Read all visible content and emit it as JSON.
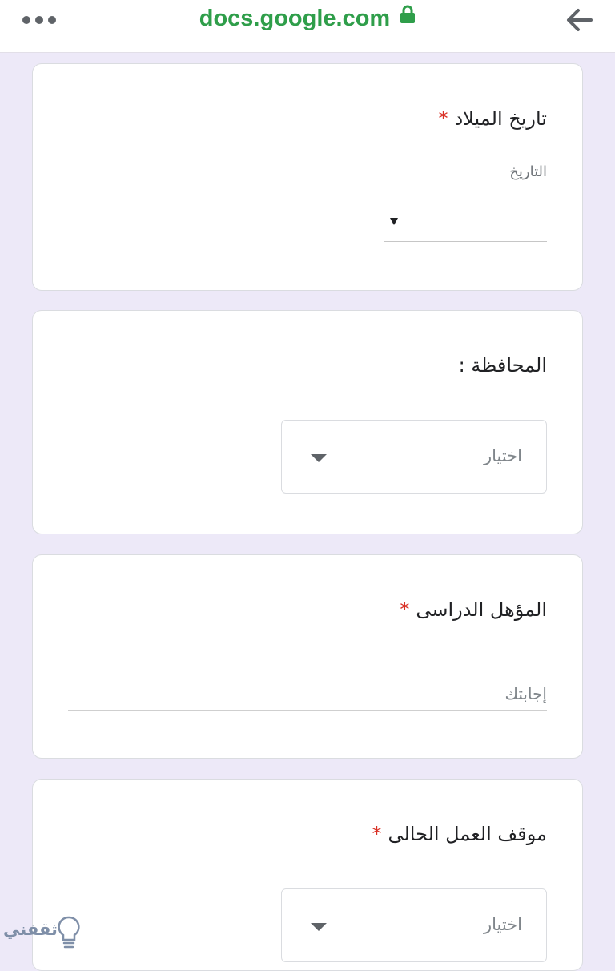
{
  "browser": {
    "url": "docs.google.com",
    "menu_icon": "more-dots-icon",
    "lock_icon": "lock-icon",
    "back_icon": "arrow-back-icon",
    "accent_color": "#2f9e4a"
  },
  "form": {
    "background_color": "#ede9f8",
    "required_mark": "*",
    "required_color": "#d93025",
    "questions": [
      {
        "title": "تاريخ الميلاد",
        "required": true,
        "sub_label": "التاريخ",
        "type": "date"
      },
      {
        "title": "المحافظة :",
        "required": false,
        "type": "dropdown",
        "selected": "اختيار"
      },
      {
        "title": "المؤهل الدراسى",
        "required": true,
        "type": "short-answer",
        "placeholder": "إجابتك"
      },
      {
        "title": "موقف العمل الحالى",
        "required": true,
        "type": "dropdown",
        "selected": "اختيار"
      }
    ]
  },
  "watermark": {
    "text": "ثقفني"
  }
}
